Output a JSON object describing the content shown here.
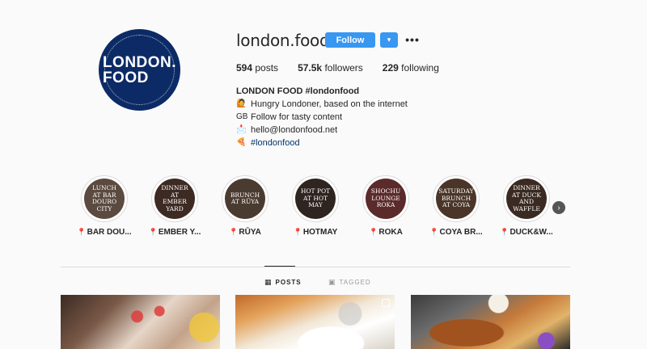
{
  "profile": {
    "avatar_text_line1": "LONDON.",
    "avatar_text_line2": "FOOD",
    "username": "london.food",
    "follow_label": "Follow",
    "dropdown_icon": "▾",
    "more_icon": "•••"
  },
  "stats": {
    "posts_count": "594",
    "posts_label": "posts",
    "followers_count": "57.5k",
    "followers_label": "followers",
    "following_count": "229",
    "following_label": "following"
  },
  "bio": {
    "name": "LONDON FOOD #londonfood",
    "line1_icon": "🙋",
    "line1": "Hungry Londoner, based on the internet",
    "line2_icon": "GB",
    "line2": "Follow for tasty content",
    "line3_icon": "📩",
    "line3": "hello@londonfood.net",
    "line4_icon": "🍕",
    "line4": "#londonfood"
  },
  "highlights": [
    {
      "title": "Lunch at Bar Douro City",
      "label": "BAR DOU...",
      "color": "#5a4a3f"
    },
    {
      "title": "Dinner at Ember Yard",
      "label": "EMBER Y...",
      "color": "#3d2a22"
    },
    {
      "title": "Brunch at Rüya",
      "label": "RŪYA",
      "color": "#4a3b30"
    },
    {
      "title": "Hot Pot at Hot May",
      "label": "HOTMAY",
      "color": "#2e2420"
    },
    {
      "title": "Shochu Lounge Roka",
      "label": "ROKA",
      "color": "#5b2a2a"
    },
    {
      "title": "Saturday Brunch at Coya",
      "label": "COYA BR...",
      "color": "#4a3528"
    },
    {
      "title": "Dinner at Duck and Waffle",
      "label": "DUCK&W...",
      "color": "#3a2a22"
    }
  ],
  "highlights_next_icon": "›",
  "tabs": {
    "posts_icon": "▦",
    "posts_label": "POSTS",
    "tagged_icon": "▣",
    "tagged_label": "TAGGED"
  }
}
